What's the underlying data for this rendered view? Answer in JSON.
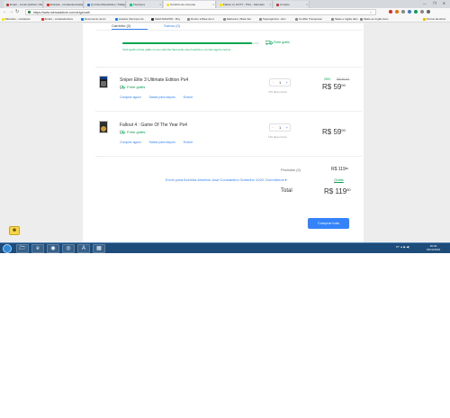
{
  "browser": {
    "tabs": [
      {
        "title": "Email – Lucas Quiltoni | Outlo",
        "color": "#d93025",
        "active": false
      },
      {
        "title": "Entrada - contatodoutoran@gmai",
        "color": "#d93025",
        "active": false
      },
      {
        "title": "(1) Inbox/Recebidos | Tráfego de n",
        "color": "#1877f2",
        "active": false
      },
      {
        "title": "Fiverr[en]",
        "color": "#1dbf73",
        "active": false
      },
      {
        "title": "Carrinho de compras",
        "color": "#ffe600",
        "active": true
      },
      {
        "title": "Fallout 4 | GOTY - PS4 – Mercado",
        "color": "#ffe600",
        "active": false
      },
      {
        "title": "Contato",
        "color": "#d93025",
        "active": false
      }
    ],
    "url": "https://www.mercadolivre.com.br/gz/cart/",
    "window_controls": "— ❐ ✕",
    "extension_colors": [
      "#d93025",
      "#e8710a",
      "#888888",
      "#3c78d8",
      "#0f9d58",
      "#888888",
      "#666666"
    ],
    "bookmarks": [
      {
        "label": "Mercado - contatodo",
        "color": "#ffe600"
      },
      {
        "label": "Email – contatodoutora",
        "color": "#d93025"
      },
      {
        "label": "Documento de Ac",
        "color": "#1a73e8"
      },
      {
        "label": "Usados (Serviços do",
        "color": "#1a73e8"
      },
      {
        "label": "GEM AMAZON - Buy",
        "color": "#333333"
      },
      {
        "label": "Dentro à Bate de H",
        "color": "#888888"
      },
      {
        "label": "Elaboram | Bate-Ser",
        "color": "#888888"
      },
      {
        "label": "Superganhos - Enc",
        "color": "#888888"
      },
      {
        "label": "Conflito Transparen",
        "color": "#888888"
      },
      {
        "label": "Skate e Inglês dam",
        "color": "#888888"
      },
      {
        "label": "Skate ao Inglês dam",
        "color": "#888888"
      },
      {
        "label": "Outros favoritos",
        "color": "#f4b400"
      }
    ]
  },
  "cart": {
    "tab_cart": "Carrinho (2)",
    "tab_saved": "Salvos (0)",
    "free_shipping_tag": "Frete grátis",
    "free_shipping_progress": 0.95,
    "free_shipping_message": "Você ganhou frete grátis no seu carrinho! Aproveite este benefício e compre agora mesmo.",
    "items": [
      {
        "title": "Sniper Elite 3 Ultimate Edition Ps4",
        "shipping": "Frete grátis",
        "actions": [
          "Comprar agora",
          "Salvar para depois",
          "Excluir"
        ],
        "quantity": "1",
        "available": "475 disponíveis",
        "discount": "26%",
        "old_price": "R$ 80,92",
        "price_main": "R$ 59",
        "price_cents": "90"
      },
      {
        "title": "Fallout 4 : Game Of The Year Ps4",
        "shipping": "Frete grátis",
        "actions": [
          "Comprar agora",
          "Salvar para depois",
          "Excluir"
        ],
        "quantity": "1",
        "available": "139 disponíveis",
        "discount": "",
        "old_price": "",
        "price_main": "R$ 59",
        "price_cents": "90"
      }
    ],
    "products_label": "Produtos (2)",
    "products_total_main": "R$ 119",
    "products_total_cents": "80",
    "shipping_to": "Envio para Avenida Almeida José Constantino Sobrinho 1020, Dorindeiros ▾",
    "shipping_cost": "Grátis",
    "total_label": "Total",
    "total_main": "R$ 119",
    "total_cents": "80",
    "buy_button": "Comprar tudo"
  },
  "taskbar": {
    "apps": [
      "🗁",
      "e",
      "◉",
      "◎",
      "A",
      "▦"
    ],
    "tray_text": "PT ▲ ▶ ◀)",
    "clock_time": "20:40",
    "clock_date": "03/12/2019"
  }
}
